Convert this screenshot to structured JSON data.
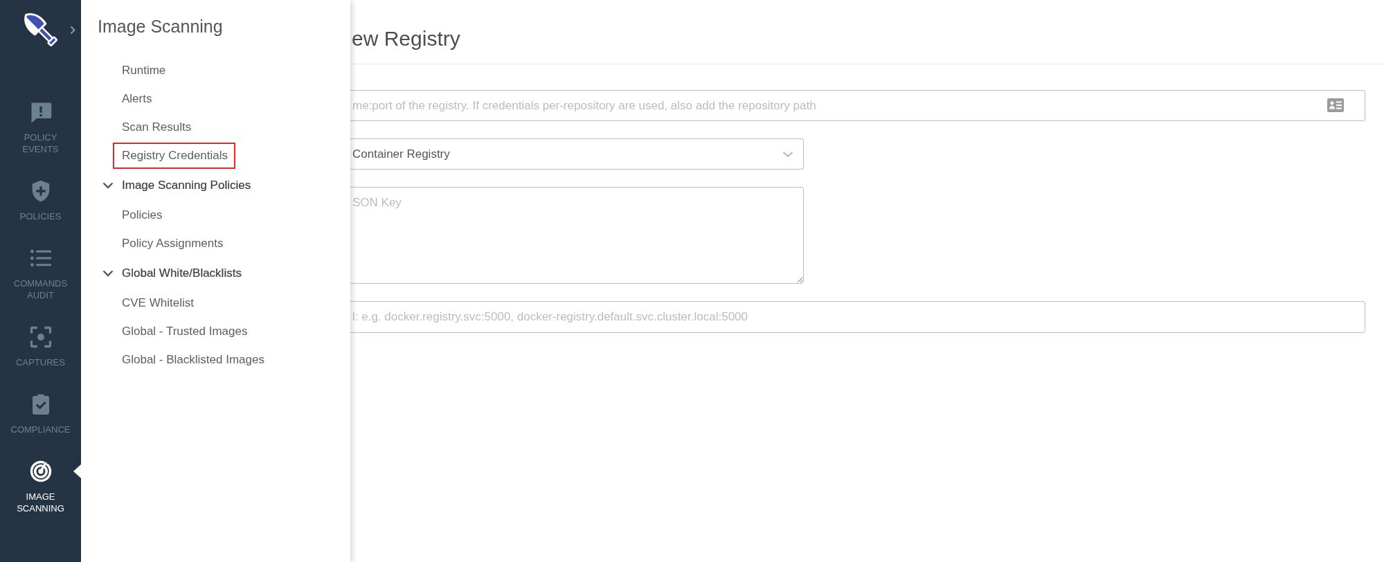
{
  "nav": {
    "items": [
      {
        "label": "POLICY EVENTS",
        "selected": false
      },
      {
        "label": "POLICIES",
        "selected": false
      },
      {
        "label": "COMMANDS AUDIT",
        "selected": false
      },
      {
        "label": "CAPTURES",
        "selected": false
      },
      {
        "label": "COMPLIANCE",
        "selected": false
      },
      {
        "label": "IMAGE SCANNING",
        "selected": true
      }
    ]
  },
  "flyout": {
    "title": "Image Scanning",
    "items": [
      {
        "kind": "link",
        "label": "Runtime",
        "highlighted": false
      },
      {
        "kind": "link",
        "label": "Alerts",
        "highlighted": false
      },
      {
        "kind": "link",
        "label": "Scan Results",
        "highlighted": false
      },
      {
        "kind": "link",
        "label": "Registry Credentials",
        "highlighted": true
      },
      {
        "kind": "group",
        "label": "Image Scanning Policies",
        "expanded": true,
        "children": [
          {
            "kind": "link",
            "label": "Policies",
            "highlighted": false
          },
          {
            "kind": "link",
            "label": "Policy Assignments",
            "highlighted": false
          }
        ]
      },
      {
        "kind": "group",
        "label": "Global White/Blacklists",
        "expanded": true,
        "children": [
          {
            "kind": "link",
            "label": "CVE Whitelist",
            "highlighted": false
          },
          {
            "kind": "link",
            "label": "Global - Trusted Images",
            "highlighted": false
          },
          {
            "kind": "link",
            "label": "Global - Blacklisted Images",
            "highlighted": false
          }
        ]
      }
    ]
  },
  "main": {
    "title": "ew Registry",
    "fields": [
      {
        "kind": "input-addon",
        "placeholder": "me:port of the registry. If credentials per-repository are used, also add the repository path"
      },
      {
        "kind": "select",
        "value": "Container Registry"
      },
      {
        "kind": "textarea",
        "placeholder": "SON Key"
      },
      {
        "kind": "input",
        "placeholder": "l: e.g. docker.registry.svc:5000, docker-registry.default.svc.cluster.local:5000"
      }
    ]
  }
}
